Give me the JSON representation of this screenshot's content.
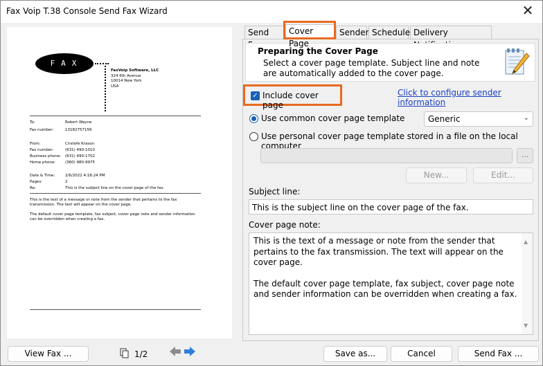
{
  "window": {
    "title": "Fax Voip T.38 Console Send Fax Wizard",
    "close_glyph": "✕"
  },
  "preview": {
    "logo_text": "FAX",
    "company": {
      "name": "FaxVoip Software, LLC",
      "address1": "324 6th Avenue",
      "address2": "10014 New York",
      "country": "USA"
    },
    "rows": [
      {
        "label": "To:",
        "value": "Robert Wayne"
      },
      {
        "label": "Fax number:",
        "value": "13182757156"
      },
      {
        "label": "From:",
        "value": "Cristofe Krason"
      },
      {
        "label": "Fax number:",
        "value": "(631) 490-1010"
      },
      {
        "label": "Business phone:",
        "value": "(631) 490-1702"
      },
      {
        "label": "Home phone:",
        "value": "(360) 980-9975"
      },
      {
        "label": "Date & Time:",
        "value": "2/6/2022 4:18:24 PM"
      },
      {
        "label": "Pages:",
        "value": "2"
      },
      {
        "label": "Re:",
        "value": "This is the subject line on the cover page of the fax."
      }
    ],
    "body1": "This is the text of a message or note from the sender that pertains to the fax transmission. The text will appear on the cover page.",
    "body2": "The default cover page template, fax subject, cover page note and sender information can be overridden when creating a fax."
  },
  "tabs": [
    {
      "label": "Send Fax",
      "active": false
    },
    {
      "label": "Cover Page",
      "active": true
    },
    {
      "label": "Sender",
      "active": false
    },
    {
      "label": "Schedule",
      "active": false
    },
    {
      "label": "Delivery Notification",
      "active": false
    }
  ],
  "info": {
    "title": "Preparing the Cover Page",
    "description": "Select a cover page template. Subject line and note are automatically added to the cover page.",
    "icon": "notepad-pencil-icon"
  },
  "include_cover": {
    "label": "Include cover page",
    "checked": true
  },
  "sender_link": "Click to configure sender information",
  "template": {
    "common_label": "Use common cover page template",
    "common_selected": true,
    "selected_template": "Generic",
    "personal_label": "Use personal cover page template stored in a file on the local computer",
    "personal_selected": false,
    "file_value": "",
    "browse_label": "...",
    "new_label": "New...",
    "edit_label": "Edit..."
  },
  "subject": {
    "label": "Subject line:",
    "value": "This is the subject line on the cover page of the fax."
  },
  "note": {
    "label": "Cover page note:",
    "para1": "This is the text of a message or note from the sender that pertains to the fax transmission. The text will appear on the cover page.",
    "para2": "The default cover page template, fax subject, cover page note and sender information can be overridden when creating a fax."
  },
  "footer": {
    "view_fax": "View Fax ...",
    "page_indicator": "1/2",
    "save_as": "Save as...",
    "cancel": "Cancel",
    "send_fax": "Send Fax ..."
  },
  "colors": {
    "highlight": "#e86a1f",
    "accent": "#1a5fb4",
    "link": "#1a3fbf",
    "arrow_prev": "#8c8c8c",
    "arrow_next": "#2f7fd8"
  }
}
